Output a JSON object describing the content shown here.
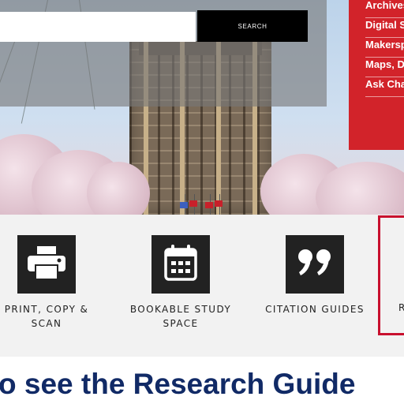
{
  "search": {
    "input_value": "",
    "button_label": "SEARCH"
  },
  "quick_links": [
    "Archives",
    "Digital S",
    "Makersp",
    "Maps, D",
    "Ask Cha"
  ],
  "services": [
    {
      "label": "PRINT, COPY &\nSCAN",
      "icon": "printer-icon"
    },
    {
      "label": "BOOKABLE STUDY\nSPACE",
      "icon": "calendar-icon"
    },
    {
      "label": "CITATION GUIDES",
      "icon": "quote-icon"
    }
  ],
  "partial_service_label": "R",
  "caption": "o see the Research Guide",
  "colors": {
    "brand_red": "#d2232a",
    "highlight": "#c8102e",
    "caption": "#112a66",
    "tile": "#222222"
  }
}
